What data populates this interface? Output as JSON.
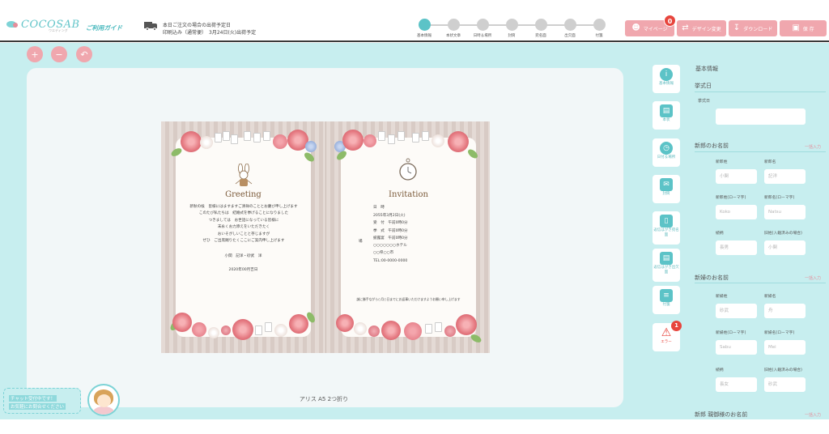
{
  "header": {
    "logo_text": "COCOSAB",
    "logo_sub": "ウエディング",
    "guide_link": "ご利用ガイド",
    "shipping_line1": "本日ご注文の場合の出荷予定日",
    "shipping_line2": "印刷込み（通常便）　3月24日(火)出荷予定",
    "steps": [
      "基本情報",
      "本状文章",
      "日時＆場所",
      "封筒",
      "宛名面",
      "出欠面",
      "付箋"
    ],
    "active_step": 0,
    "buttons": {
      "mypage": "マイページ",
      "mypage_icon": "person-icon",
      "mypage_badge": "0",
      "design": "デザイン変更",
      "design_icon": "swap-icon",
      "download": "ダウンロード",
      "download_icon": "download-icon",
      "save": "保 存",
      "save_icon": "save-icon"
    },
    "colors": {
      "accent": "#5cc3c7",
      "button": "#f0a7ae",
      "badge": "#e7453d"
    }
  },
  "toolbar": {
    "zoom_in_icon": "+",
    "zoom_out_icon": "−",
    "undo_icon": "↶"
  },
  "preview": {
    "template_name": "アリス A5 2つ折り",
    "left": {
      "heading": "Greeting",
      "lines": [
        "新秋の候　皆様にはますますご清祥のこととお慶び申し上げます",
        "このたび私たちは　結婚式を挙げることになりました",
        "つきましては　お世話になっている皆様に",
        "末永くお力添えをいただきたく",
        "おいそがしいことと存じますが",
        "ぜひ　ご出席賜りたくここにご案内申し上げます"
      ],
      "names": "小関　記洋・砂武　洋",
      "date": "2020年00月吉日"
    },
    "right": {
      "heading": "Invitation",
      "label_datetime": "日　時",
      "label_venue": "場",
      "lines": [
        "2055年3月2日(火)",
        "受　付　午前0時0分",
        "挙　式　午前0時0分",
        "披露宴　午前0時0分",
        "○○○○○○○ホテル",
        "○○県○○市",
        "TEL:00-0000-0000"
      ],
      "footer": "誠に勝手ながら○月○日までにお返事いただけますようお願い申し上げます"
    }
  },
  "chat": {
    "line1": "チャット受付中です！",
    "line2": "お気軽にお問合せください"
  },
  "sidebar_nav": [
    {
      "label": "基本情報",
      "icon": "info-icon",
      "glyph": "i"
    },
    {
      "label": "本状",
      "icon": "book-icon",
      "glyph": "▤"
    },
    {
      "label": "日付＆場所",
      "icon": "clock-icon",
      "glyph": "◷"
    },
    {
      "label": "封筒",
      "icon": "envelope-icon",
      "glyph": "✉"
    },
    {
      "label": "返信はがき宛名面",
      "icon": "postcard-icon",
      "glyph": "▯"
    },
    {
      "label": "返信はがき出欠面",
      "icon": "reply-card-icon",
      "glyph": "▤"
    },
    {
      "label": "付箋",
      "icon": "note-icon",
      "glyph": "≡"
    },
    {
      "label": "エラー",
      "icon": "warning-icon",
      "glyph": "⚠",
      "badge": "1"
    }
  ],
  "form": {
    "title": "基本情報",
    "section_wedding_date": "挙式日",
    "wedding_date_label": "挙式日",
    "bulk_label": "一括入力",
    "groom": {
      "title": "新郎のお名前",
      "fields": [
        {
          "label": "新郎姓",
          "placeholder": "小関"
        },
        {
          "label": "新郎名",
          "placeholder": "記洋"
        },
        {
          "label": "新郎姓(ローマ字)",
          "placeholder": "Koko"
        },
        {
          "label": "新郎名(ローマ字)",
          "placeholder": "Natsu"
        },
        {
          "label": "続柄",
          "placeholder": "長男"
        },
        {
          "label": "旧姓(入籍済みの場合)",
          "placeholder": "小関"
        }
      ]
    },
    "bride": {
      "title": "新婦のお名前",
      "fields": [
        {
          "label": "新婦姓",
          "placeholder": "砂武"
        },
        {
          "label": "新婦名",
          "placeholder": "舟"
        },
        {
          "label": "新婦姓(ローマ字)",
          "placeholder": "Sabu"
        },
        {
          "label": "新婦名(ローマ字)",
          "placeholder": "Mei"
        },
        {
          "label": "続柄",
          "placeholder": "長女"
        },
        {
          "label": "旧姓(入籍済みの場合)",
          "placeholder": "砂武"
        }
      ]
    },
    "groom_parent_title": "新郎 親御様のお名前"
  }
}
